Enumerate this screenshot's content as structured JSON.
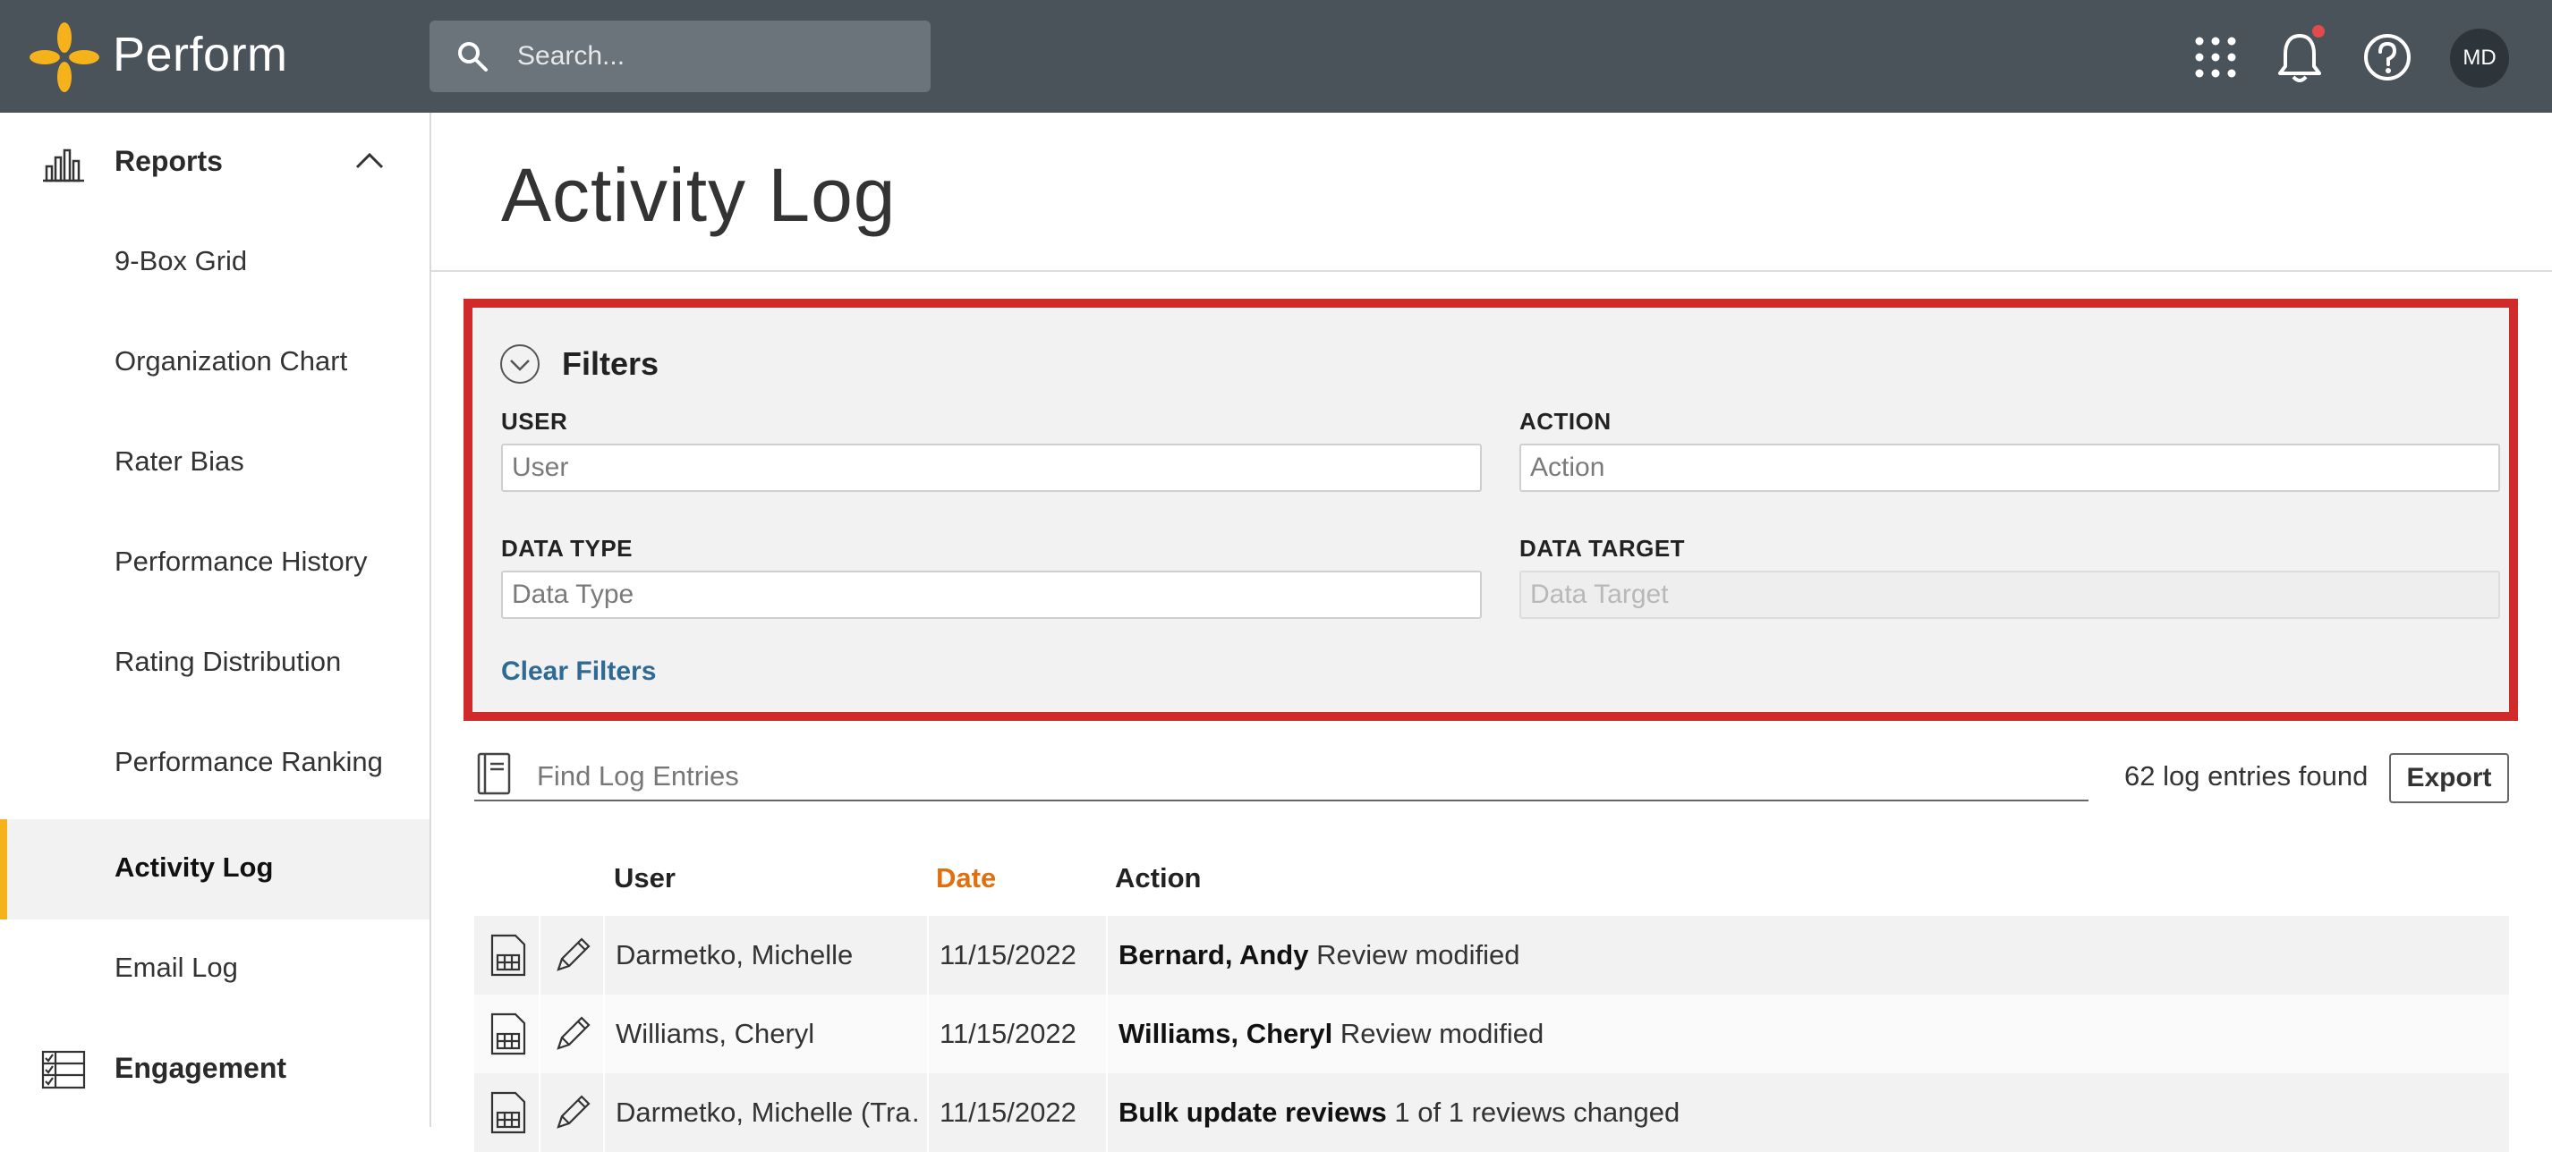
{
  "app": {
    "brand": "Perform"
  },
  "search": {
    "placeholder": "Search..."
  },
  "user": {
    "initials": "MD"
  },
  "sidebar": {
    "reports_label": "Reports",
    "items": [
      {
        "label": "9-Box Grid"
      },
      {
        "label": "Organization Chart"
      },
      {
        "label": "Rater Bias"
      },
      {
        "label": "Performance History"
      },
      {
        "label": "Rating Distribution"
      },
      {
        "label": "Performance Ranking"
      },
      {
        "label": "Activity Log",
        "active": true
      },
      {
        "label": "Email Log"
      }
    ],
    "engagement_label": "Engagement"
  },
  "page": {
    "title": "Activity Log"
  },
  "filters": {
    "title": "Filters",
    "user_label": "USER",
    "user_placeholder": "User",
    "action_label": "ACTION",
    "action_placeholder": "Action",
    "datatype_label": "DATA TYPE",
    "datatype_placeholder": "Data Type",
    "datatarget_label": "DATA TARGET",
    "datatarget_placeholder": "Data Target",
    "clear_label": "Clear Filters"
  },
  "log": {
    "find_placeholder": "Find Log Entries",
    "count_text": "62 log entries found",
    "export_label": "Export",
    "columns": {
      "user": "User",
      "date": "Date",
      "action": "Action"
    },
    "rows": [
      {
        "user": "Darmetko, Michelle",
        "date": "11/15/2022",
        "action_bold": "Bernard, Andy",
        "action_rest": " Review modified"
      },
      {
        "user": "Williams, Cheryl",
        "date": "11/15/2022",
        "action_bold": "Williams, Cheryl",
        "action_rest": " Review modified"
      },
      {
        "user": "Darmetko, Michelle (Tra…",
        "date": "11/15/2022",
        "action_bold": "Bulk update reviews",
        "action_rest": " 1 of 1 reviews changed"
      }
    ]
  },
  "colors": {
    "topbar": "#4a525a",
    "accent": "#f6b21a",
    "date_header": "#e0700f",
    "link": "#2f6a95",
    "highlight_border": "#d12a2a"
  }
}
